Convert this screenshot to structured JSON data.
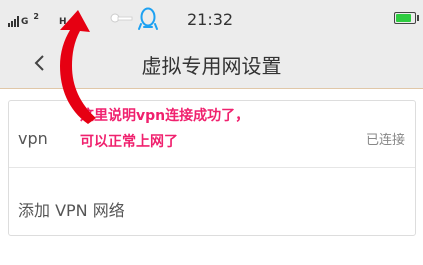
{
  "status_bar": {
    "network_label": "G",
    "network_sup": "2",
    "data_label": "H",
    "time": "21:32",
    "battery_level": 0.85,
    "icons": [
      "signal-icon",
      "key-icon",
      "qq-icon",
      "battery-icon"
    ]
  },
  "header": {
    "title": "虚拟专用网设置",
    "back_icon": "chevron-left-icon"
  },
  "vpn_list": {
    "items": [
      {
        "label": "vpn",
        "status": "已连接"
      }
    ],
    "add_label": "添加 VPN 网络"
  },
  "annotation": {
    "line1": "这里说明vpn连接成功了，",
    "line2": "可以正常上网了",
    "color": "#f0216e"
  },
  "colors": {
    "status_bar_bg": "#ececec",
    "qq_blue": "#1da1f2",
    "battery_green": "#2ecc40"
  }
}
